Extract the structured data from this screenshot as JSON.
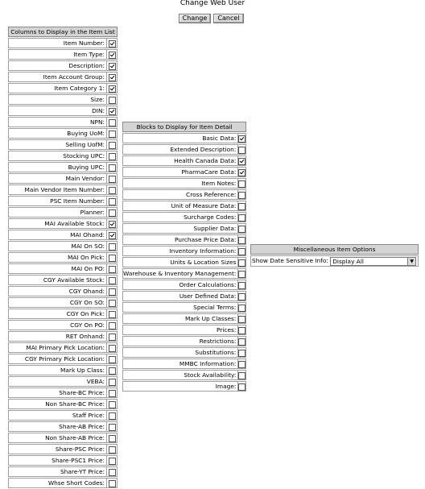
{
  "page": {
    "title": "Change Web User"
  },
  "buttons": {
    "change": "Change",
    "cancel": "Cancel"
  },
  "columns_panel": {
    "header": "Columns to Display in the Item List",
    "items": [
      {
        "label": "Item Number:",
        "checked": true
      },
      {
        "label": "Item Type:",
        "checked": true
      },
      {
        "label": "Description:",
        "checked": true
      },
      {
        "label": "Item Account Group:",
        "checked": true
      },
      {
        "label": "Item Category 1:",
        "checked": true
      },
      {
        "label": "Size:",
        "checked": false
      },
      {
        "label": "DIN:",
        "checked": true
      },
      {
        "label": "NPN:",
        "checked": false
      },
      {
        "label": "Buying UoM:",
        "checked": false
      },
      {
        "label": "Selling UofM:",
        "checked": false
      },
      {
        "label": "Stocking UPC:",
        "checked": false
      },
      {
        "label": "Buying UPC:",
        "checked": false
      },
      {
        "label": "Main Vendor:",
        "checked": false
      },
      {
        "label": "Main Vendor Item Number:",
        "checked": false
      },
      {
        "label": "PSC Item Number:",
        "checked": false
      },
      {
        "label": "Planner:",
        "checked": false
      },
      {
        "label": "MAI Available Stock:",
        "checked": true
      },
      {
        "label": "MAI Ohand:",
        "checked": true
      },
      {
        "label": "MAI On SO:",
        "checked": false
      },
      {
        "label": "MAI On Pick:",
        "checked": false
      },
      {
        "label": "MAI On PO:",
        "checked": false
      },
      {
        "label": "CGY Available Stock:",
        "checked": false
      },
      {
        "label": "CGY Ohand:",
        "checked": false
      },
      {
        "label": "CGY On SO:",
        "checked": false
      },
      {
        "label": "CGY On Pick:",
        "checked": false
      },
      {
        "label": "CGY On PO:",
        "checked": false
      },
      {
        "label": "RET Onhand:",
        "checked": false
      },
      {
        "label": "MAI Primary Pick Location:",
        "checked": false
      },
      {
        "label": "CGY Primary Pick Location:",
        "checked": false
      },
      {
        "label": "Mark Up Class:",
        "checked": false
      },
      {
        "label": "VEBA:",
        "checked": false
      },
      {
        "label": "Share-BC Price:",
        "checked": false
      },
      {
        "label": "Non Share-BC Price:",
        "checked": false
      },
      {
        "label": "Staff Price:",
        "checked": false
      },
      {
        "label": "Share-AB Price:",
        "checked": false
      },
      {
        "label": "Non Share-AB Price:",
        "checked": false
      },
      {
        "label": "Share-PSC Price:",
        "checked": false
      },
      {
        "label": "Share-PSC1 Price:",
        "checked": false
      },
      {
        "label": "Share-YT Price:",
        "checked": false
      },
      {
        "label": "Whse Short Codes:",
        "checked": false
      }
    ]
  },
  "blocks_panel": {
    "header": "Blocks to Display for Item Detail",
    "items": [
      {
        "label": "Basic Data:",
        "checked": true
      },
      {
        "label": "Extended Description:",
        "checked": false
      },
      {
        "label": "Health Canada Data:",
        "checked": true
      },
      {
        "label": "PharmaCare Data:",
        "checked": true
      },
      {
        "label": "Item Notes:",
        "checked": false
      },
      {
        "label": "Cross Reference:",
        "checked": false
      },
      {
        "label": "Unit of Measure Data:",
        "checked": false
      },
      {
        "label": "Surcharge Codes:",
        "checked": false
      },
      {
        "label": "Supplier Data:",
        "checked": false
      },
      {
        "label": "Purchase Price Data:",
        "checked": false
      },
      {
        "label": "Inventory Information:",
        "checked": false
      },
      {
        "label": "Units & Location Sizes",
        "checked": false
      },
      {
        "label": "Warehouse & Inventory Management:",
        "checked": false
      },
      {
        "label": "Order Calculations:",
        "checked": false
      },
      {
        "label": "User Defined Data:",
        "checked": false
      },
      {
        "label": "Special Terms:",
        "checked": false
      },
      {
        "label": "Mark Up Classes:",
        "checked": false
      },
      {
        "label": "Prices:",
        "checked": false
      },
      {
        "label": "Restrictions:",
        "checked": false
      },
      {
        "label": "Substitutions:",
        "checked": false
      },
      {
        "label": "MMBC Information:",
        "checked": false
      },
      {
        "label": "Stock Availability:",
        "checked": false
      },
      {
        "label": "Image:",
        "checked": false
      }
    ]
  },
  "misc_panel": {
    "header": "Miscellaneous Item Options",
    "label": "Show Date Sensitive Info:",
    "selected": "Display All"
  },
  "icons": {
    "checkbox_checked": "checkbox-checked-icon",
    "dropdown": "chevron-down-icon"
  }
}
